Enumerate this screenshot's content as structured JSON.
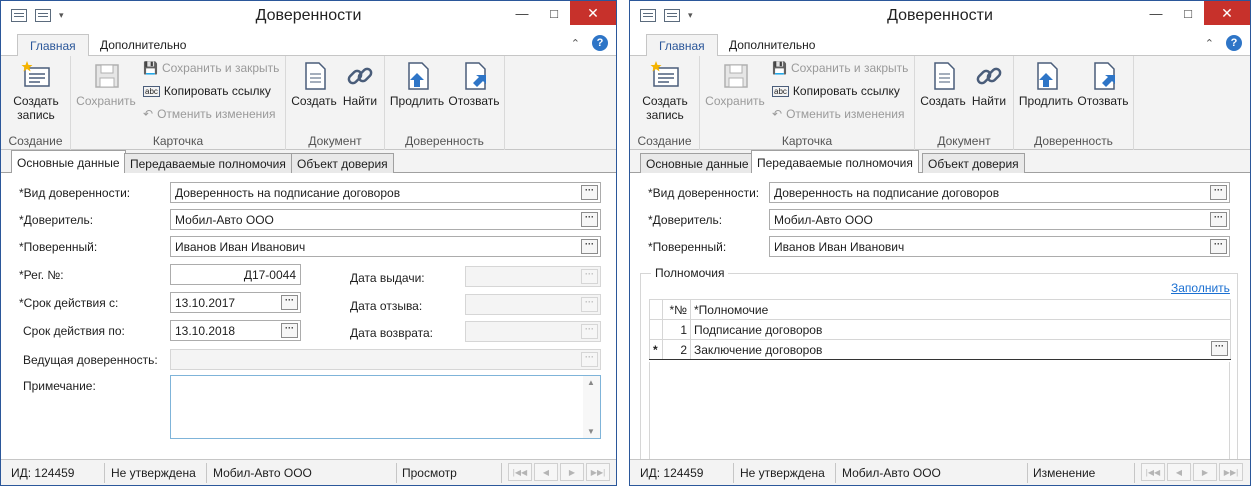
{
  "windows": [
    {
      "title": "Доверенности",
      "ribbon": {
        "tab_main": "Главная",
        "tab_extra": "Дополнительно",
        "create_record": "Создать запись",
        "group_create": "Создание",
        "save": "Сохранить",
        "save_close": "Сохранить и закрыть",
        "copy_link": "Копировать ссылку",
        "undo": "Отменить изменения",
        "group_card": "Карточка",
        "doc_create": "Создать",
        "doc_find": "Найти",
        "group_doc": "Документ",
        "extend": "Продлить",
        "revoke": "Отозвать",
        "group_poa": "Доверенность"
      },
      "doc_tabs": [
        "Основные данные",
        "Передаваемые полномочия",
        "Объект доверия"
      ],
      "active_tab": 0,
      "form": {
        "type_label": "*Вид доверенности:",
        "type_value": "Доверенность на подписание договоров",
        "principal_label": "*Доверитель:",
        "principal_value": "Мобил-Авто ООО",
        "attorney_label": "*Поверенный:",
        "attorney_value": "Иванов Иван Иванович",
        "reg_label": "*Рег. №:",
        "reg_value": "Д17-0044",
        "from_label": "*Срок действия с:",
        "from_value": "13.10.2017",
        "to_label": "Срок действия по:",
        "to_value": "13.10.2018",
        "issue_label": "Дата выдачи:",
        "revoke_label": "Дата отзыва:",
        "return_label": "Дата возврата:",
        "lead_label": "Ведущая доверенность:",
        "note_label": "Примечание:"
      },
      "status": {
        "id": "ИД: 124459",
        "approval": "Не утверждена",
        "org": "Мобил-Авто ООО",
        "mode": "Просмотр"
      }
    },
    {
      "title": "Доверенности",
      "ribbon": {
        "tab_main": "Главная",
        "tab_extra": "Дополнительно",
        "create_record": "Создать запись",
        "group_create": "Создание",
        "save": "Сохранить",
        "save_close": "Сохранить и закрыть",
        "copy_link": "Копировать ссылку",
        "undo": "Отменить изменения",
        "group_card": "Карточка",
        "doc_create": "Создать",
        "doc_find": "Найти",
        "group_doc": "Документ",
        "extend": "Продлить",
        "revoke": "Отозвать",
        "group_poa": "Доверенность"
      },
      "doc_tabs": [
        "Основные данные",
        "Передаваемые полномочия",
        "Объект доверия"
      ],
      "active_tab": 1,
      "form": {
        "type_label": "*Вид доверенности:",
        "type_value": "Доверенность на подписание договоров",
        "principal_label": "*Доверитель:",
        "principal_value": "Мобил-Авто ООО",
        "attorney_label": "*Поверенный:",
        "attorney_value": "Иванов Иван Иванович"
      },
      "powers": {
        "group_title": "Полномочия",
        "fill_link": "Заполнить",
        "col_num": "*№",
        "col_power": "*Полномочие",
        "rows": [
          {
            "num": "1",
            "power": "Подписание договоров"
          },
          {
            "num": "2",
            "power": "Заключение договоров"
          }
        ],
        "new_row_marker": "*"
      },
      "status": {
        "id": "ИД: 124459",
        "approval": "Не утверждена",
        "org": "Мобил-Авто ООО",
        "mode": "Изменение"
      }
    }
  ],
  "colors": {
    "accent": "#2b579a",
    "close": "#c7312b",
    "link": "#1a6fd1"
  }
}
